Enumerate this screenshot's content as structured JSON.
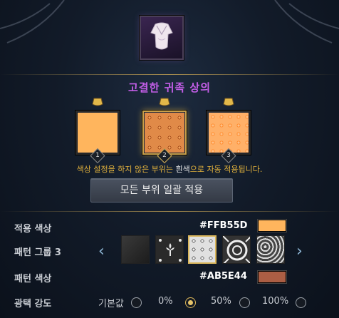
{
  "item": {
    "name": "고결한 귀족 상의",
    "icon": "noble-top-icon"
  },
  "parts": [
    {
      "number": "1",
      "color": "#FFB55D",
      "selected": false
    },
    {
      "number": "2",
      "color": "#C8662A",
      "selected": true
    },
    {
      "number": "3",
      "color": "#FF9A3E",
      "selected": false
    }
  ],
  "hint": {
    "part1": "색상 설정을 하지 않은 부위는 ",
    "white": "흰색",
    "part2": "으로 자동 적용됩니다."
  },
  "apply_all_button": "모든 부위 일괄 적용",
  "applied_color": {
    "label": "적용 색상",
    "hex": "#FFB55D",
    "color": "#FFB55D"
  },
  "pattern_group": {
    "label": "패턴 그룹 3",
    "patterns": [
      "pattern-dark",
      "pattern-fleur",
      "pattern-damask",
      "pattern-medallion",
      "pattern-floral"
    ],
    "selected_index": 2
  },
  "pattern_color": {
    "label": "패턴 색상",
    "hex": "#AB5E44",
    "color": "#AB5E44"
  },
  "gloss": {
    "label": "광택 강도",
    "options": [
      "기본값",
      "0%",
      "50%",
      "100%"
    ],
    "selected_index": 1
  }
}
